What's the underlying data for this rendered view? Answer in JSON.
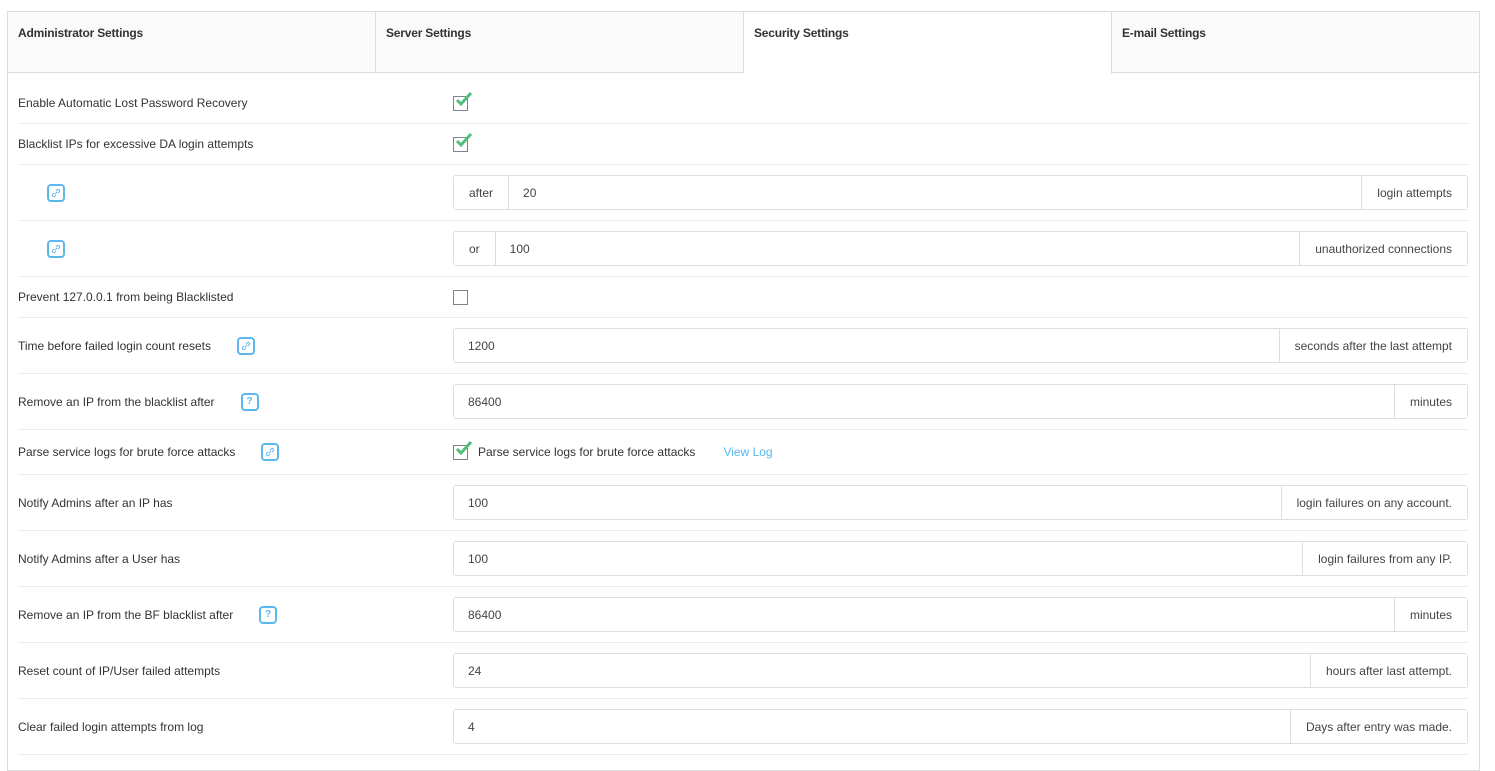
{
  "tabs": [
    {
      "label": "Administrator Settings",
      "active": false
    },
    {
      "label": "Server Settings",
      "active": false
    },
    {
      "label": "Security Settings",
      "active": true
    },
    {
      "label": "E-mail Settings",
      "active": false
    }
  ],
  "settings": {
    "auto_lost_password": {
      "label": "Enable Automatic Lost Password Recovery",
      "checked": true
    },
    "blacklist_ips": {
      "label": "Blacklist IPs for excessive DA login attempts",
      "checked": true
    },
    "after_attempts": {
      "prefix": "after",
      "value": "20",
      "suffix": "login attempts",
      "icon": "link-icon"
    },
    "unauth_connections": {
      "prefix": "or",
      "value": "100",
      "suffix": "unauthorized connections",
      "icon": "link-icon"
    },
    "prevent_localhost": {
      "label": "Prevent 127.0.0.1 from being Blacklisted",
      "checked": false
    },
    "failed_login_reset": {
      "label": "Time before failed login count resets",
      "value": "1200",
      "suffix": "seconds after the last attempt",
      "icon": "link-icon"
    },
    "remove_ip_blacklist": {
      "label": "Remove an IP from the blacklist after",
      "value": "86400",
      "suffix": "minutes",
      "icon": "help-icon"
    },
    "parse_logs": {
      "label": "Parse service logs for brute force attacks",
      "checkbox_label": "Parse service logs for brute force attacks",
      "checked": true,
      "link": "View Log",
      "icon": "link-icon"
    },
    "notify_ip": {
      "label": "Notify Admins after an IP has",
      "value": "100",
      "suffix": "login failures on any account."
    },
    "notify_user": {
      "label": "Notify Admins after a User has",
      "value": "100",
      "suffix": "login failures from any IP."
    },
    "remove_bf_blacklist": {
      "label": "Remove an IP from the BF blacklist after",
      "value": "86400",
      "suffix": "minutes",
      "icon": "help-icon"
    },
    "reset_count": {
      "label": "Reset count of IP/User failed attempts",
      "value": "24",
      "suffix": "hours after last attempt."
    },
    "clear_failed": {
      "label": "Clear failed login attempts from log",
      "value": "4",
      "suffix": "Days after entry was made."
    }
  },
  "icons": {
    "help_glyph": "?"
  },
  "colors": {
    "accent": "#5bb8ee",
    "check": "#4fbf7a",
    "border": "#dcdcdc"
  }
}
